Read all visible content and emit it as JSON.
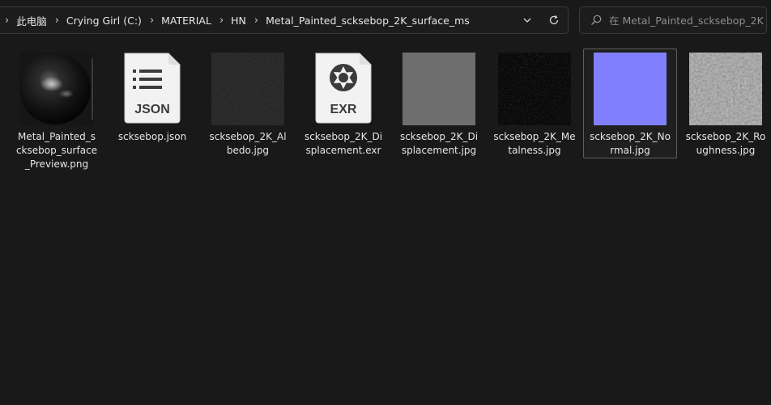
{
  "address_bar": {
    "breadcrumbs": [
      "此电脑",
      "Crying Girl (C:)",
      "MATERIAL",
      "HN",
      "Metal_Painted_scksebop_2K_surface_ms"
    ]
  },
  "search": {
    "placeholder": "在 Metal_Painted_scksebop_2K..."
  },
  "icons": {
    "dropdown": "chevron-down-icon",
    "refresh": "refresh-icon",
    "search": "search-icon",
    "json": "json-file-icon",
    "exr": "exr-file-icon"
  },
  "files": [
    {
      "name": "Metal_Painted_scksebop_surface_Preview.png",
      "thumb": "sphere"
    },
    {
      "name": "scksebop.json",
      "thumb": "json",
      "badge": "JSON"
    },
    {
      "name": "scksebop_2K_Albedo.jpg",
      "thumb": "albedo"
    },
    {
      "name": "scksebop_2K_Displacement.exr",
      "thumb": "exr",
      "badge": "EXR"
    },
    {
      "name": "scksebop_2K_Displacement.jpg",
      "thumb": "displacement",
      "color": "#6e6e6e"
    },
    {
      "name": "scksebop_2K_Metalness.jpg",
      "thumb": "metalness"
    },
    {
      "name": "scksebop_2K_Normal.jpg",
      "thumb": "normal",
      "color": "#8080ff",
      "selected": true
    },
    {
      "name": "scksebop_2K_Roughness.jpg",
      "thumb": "roughness"
    }
  ]
}
